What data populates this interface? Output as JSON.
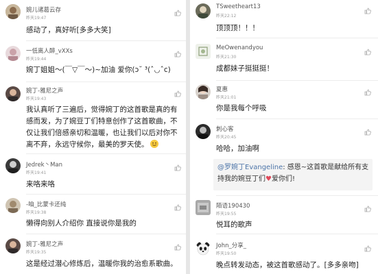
{
  "left": {
    "comments": [
      {
        "name": "婉儿诸葛云存",
        "time": "昨天19:47",
        "lines": [
          "感动了，真好听[多多大笑]"
        ]
      },
      {
        "name": "一低离人醉_vXXs",
        "time": "昨天19:44",
        "lines": [
          "婉丁姐姐～(￣▽￣～)~加油 爱你(ↄ˘ ³(ˆ◡ˆc)"
        ]
      },
      {
        "name": "婉丁-雅尼之声",
        "time": "昨天19:43",
        "lines": [
          "我认真听了三遍后，觉得婉丁的这首歌是真的有",
          "感而发，为了婉豆丁们特意创作了这首歌曲，不",
          "仅让我们倍感亲切和温暖，也让我们以后对你不",
          "离不弃，永远守候你，最美的罗天使。"
        ]
      },
      {
        "name": "Jedrek丶Man",
        "time": "昨天19:41",
        "lines": [
          "来咯来咯"
        ]
      },
      {
        "name": "-咱_比蒙卡还纯",
        "time": "昨天19:38",
        "lines": [
          "懒得向别人介绍你 直接说你是我的"
        ]
      },
      {
        "name": "婉丁-雅尼之声",
        "time": "昨天19:35",
        "lines": [
          "这是经过潜心修炼后，温暖你我的治愈系歌曲。"
        ]
      }
    ]
  },
  "right": {
    "comments": [
      {
        "name": "TSweetheart13",
        "time": "昨天22:12",
        "lines": [
          "顶顶顶！！！"
        ]
      },
      {
        "name": "MeOwenandyou",
        "time": "昨天21:30",
        "lines": [
          "成都妹子挺挺挺！"
        ]
      },
      {
        "name": "夏惠",
        "time": "昨天21:01",
        "lines": [
          "你是我每个呼吸"
        ]
      },
      {
        "name": "刺心客",
        "time": "昨天20:45",
        "lines": [
          "哈哈，加油啊"
        ]
      },
      {
        "name": "陌语190430",
        "time": "昨天19:55",
        "lines": [
          "悦耳的歌声"
        ]
      },
      {
        "name": "John_分享_",
        "time": "昨天19:50",
        "lines": [
          "晚点转发动态，被这首歌感动了。[多多亲吻]"
        ]
      }
    ],
    "reply": {
      "mention": "@罗婉丁Evangeline",
      "line1_rest": ": 感恩~这首歌是献给所有支",
      "line2_pre": "持我的婉豆丁们",
      "heart": "♥",
      "line2_post": "爱你们!"
    }
  },
  "icons": {
    "like": "thumbs-up-icon",
    "smile": "smile-emoji-icon",
    "heart": "heart-emoji-icon"
  },
  "colors": {
    "mention": "#4c74a8",
    "heart": "#e0495a",
    "divider": "#ececec",
    "background": "#e6e6e6"
  }
}
